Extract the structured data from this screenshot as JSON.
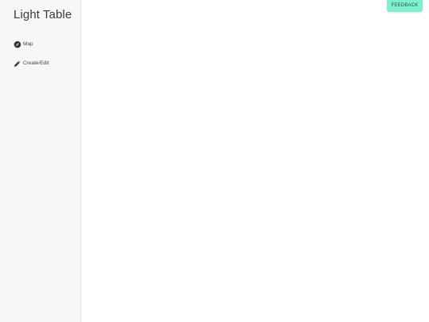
{
  "app": {
    "title": "Light Table"
  },
  "sidebar": {
    "items": [
      {
        "label": "Map",
        "icon": "compass-icon"
      },
      {
        "label": "Create/Edit",
        "icon": "pencil-icon"
      }
    ]
  },
  "header": {
    "feedback_label": "FEEDBACK"
  },
  "colors": {
    "sidebar_background": "#f7f7f7",
    "feedback_button": "#7ff0cf",
    "icon": "#333333",
    "text": "#444444"
  }
}
